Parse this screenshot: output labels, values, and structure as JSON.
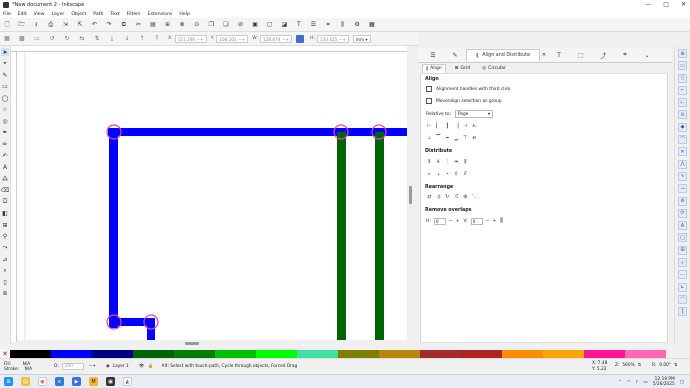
{
  "window": {
    "title": "*New document 2 - Inkscape",
    "controls": [
      "—",
      "□",
      "✕"
    ]
  },
  "menu": [
    "File",
    "Edit",
    "View",
    "Layer",
    "Object",
    "Path",
    "Text",
    "Filters",
    "Extensions",
    "Help"
  ],
  "toolbar": {
    "x": {
      "label": "X:",
      "value": "151.160"
    },
    "y": {
      "label": "Y:",
      "value": "108.101"
    },
    "w": {
      "label": "W:",
      "value": "128.474"
    },
    "h": {
      "label": "H:",
      "value": "133.425"
    },
    "unit": "mm"
  },
  "dock": {
    "active_tab": "Align and Distribute",
    "subtabs": [
      "Align",
      "Grid",
      "Circular"
    ],
    "align_heading": "Align",
    "option1": "Alignment handles with third click",
    "option2": "Move/align selection as group",
    "relative_label": "Relative to:",
    "relative_value": "Page",
    "distribute_heading": "Distribute",
    "rearrange_heading": "Rearrange",
    "remove_overlaps_heading": "Remove overlaps",
    "h_label": "H:",
    "h_value": "0",
    "v_label": "V:",
    "v_value": "0"
  },
  "palette": [
    "#000000",
    "#0000ff",
    "#000080",
    "#006400",
    "#008000",
    "#00c000",
    "#00ff00",
    "#40e0a0",
    "#808000",
    "#b8860b",
    "#a52a2a",
    "#b22222",
    "#ff8c00",
    "#ffa500",
    "#ff1493",
    "#ff69b4"
  ],
  "status": {
    "fill_label": "Fill:",
    "fill_value": "N/A",
    "stroke_label": "Stroke:",
    "stroke_value": "N/A",
    "opacity_label": "O:",
    "opacity_value": "100",
    "layer": "Layer 1",
    "message": "Alt: Select with touch-path, Cycle through objects, Forced Drag",
    "x_label": "X:",
    "x_value": "7.48",
    "y_label": "Y:",
    "y_value": "5.22",
    "zoom_label": "Z:",
    "zoom": "560%",
    "rotate_label": "R:",
    "rotation": "0.00°"
  },
  "clock": {
    "time": "12:19 PM",
    "date": "5/26/2025"
  },
  "colors": {
    "blue": "#0000ff",
    "green": "#006400",
    "handle": "#e040c0",
    "accent": "#3f6fc6"
  }
}
